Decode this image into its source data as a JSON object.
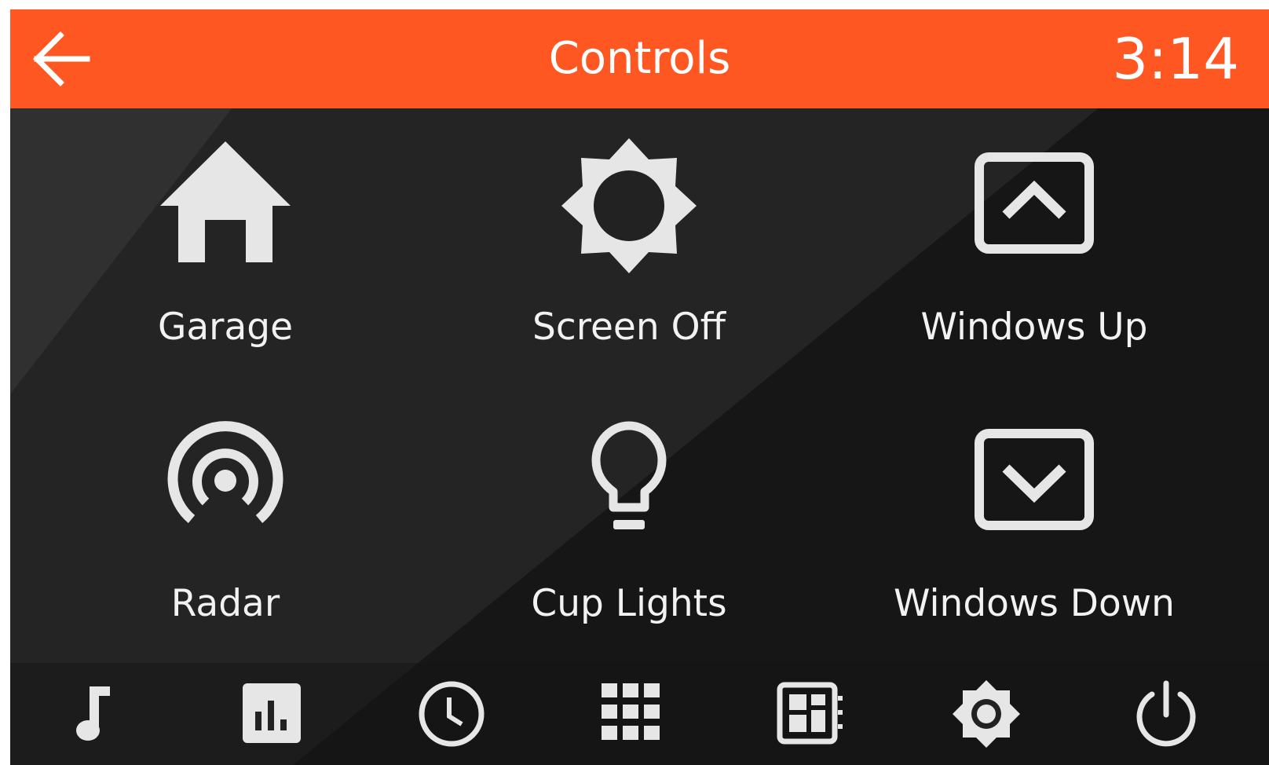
{
  "header": {
    "title": "Controls",
    "time": "3:14",
    "back_icon": "arrow-back-icon",
    "background_color": "#ff5722"
  },
  "tiles": [
    {
      "label": "Garage",
      "icon": "home-icon"
    },
    {
      "label": "Screen Off",
      "icon": "brightness-icon"
    },
    {
      "label": "Windows Up",
      "icon": "window-up-icon"
    },
    {
      "label": "Radar",
      "icon": "radar-icon"
    },
    {
      "label": "Cup Lights",
      "icon": "lightbulb-icon"
    },
    {
      "label": "Windows Down",
      "icon": "window-down-icon"
    }
  ],
  "bottom_nav": [
    {
      "icon": "music-note-icon"
    },
    {
      "icon": "bar-chart-icon"
    },
    {
      "icon": "clock-icon"
    },
    {
      "icon": "app-grid-icon"
    },
    {
      "icon": "dashboard-icon"
    },
    {
      "icon": "settings-icon"
    },
    {
      "icon": "power-icon"
    }
  ],
  "colors": {
    "accent": "#ff5722",
    "icon": "#e6e6e6",
    "background": "#1c1c1c"
  }
}
